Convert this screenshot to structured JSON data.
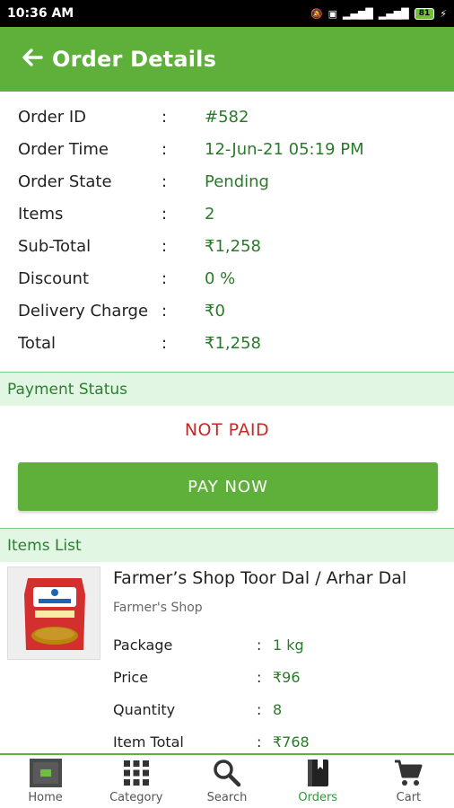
{
  "status_bar": {
    "time": "10:36 AM",
    "battery": "81"
  },
  "app_bar": {
    "title": "Order Details"
  },
  "order": {
    "rows": [
      {
        "label": "Order ID",
        "value": "#582"
      },
      {
        "label": "Order Time",
        "value": "12-Jun-21 05:19 PM"
      },
      {
        "label": "Order State",
        "value": "Pending"
      },
      {
        "label": "Items",
        "value": "2"
      },
      {
        "label": "Sub-Total",
        "value": "₹1,258"
      },
      {
        "label": "Discount",
        "value": "0 %"
      },
      {
        "label": "Delivery Charge",
        "value": "₹0"
      },
      {
        "label": "Total",
        "value": "₹1,258"
      }
    ]
  },
  "payment": {
    "heading": "Payment Status",
    "status": "NOT PAID",
    "button": "PAY NOW"
  },
  "items_list": {
    "heading": "Items List",
    "items": [
      {
        "name": "Farmer’s Shop Toor Dal / Arhar Dal",
        "brand": "Farmer's Shop",
        "details": [
          {
            "label": "Package",
            "value": "1 kg"
          },
          {
            "label": "Price",
            "value": "₹96"
          },
          {
            "label": "Quantity",
            "value": "8"
          },
          {
            "label": "Item Total",
            "value": "₹768"
          }
        ]
      }
    ]
  },
  "bottom_nav": {
    "items": [
      {
        "label": "Home",
        "icon": "home-logo-icon"
      },
      {
        "label": "Category",
        "icon": "grid-icon"
      },
      {
        "label": "Search",
        "icon": "search-icon"
      },
      {
        "label": "Orders",
        "icon": "orders-book-icon",
        "active": true
      },
      {
        "label": "Cart",
        "icon": "cart-icon"
      }
    ]
  },
  "colors": {
    "primary": "#5fb03a",
    "value_text": "#2b7a2b",
    "not_paid": "#c62828",
    "section_bg": "#e2f6e4"
  }
}
